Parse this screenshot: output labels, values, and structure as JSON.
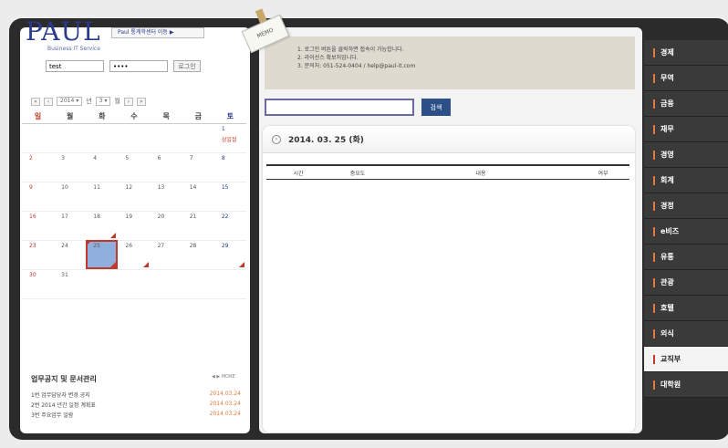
{
  "header": {
    "logo": "PAUL",
    "logo_sub": "Business IT Service",
    "top_button": "Paul 통계학센터 이동 ▶"
  },
  "login": {
    "id_value": "test",
    "pw_value": "••••",
    "button": "로그인"
  },
  "calendar": {
    "year": "2014",
    "year_suffix": "년",
    "month": "3",
    "month_suffix": "월",
    "weekdays": [
      "일",
      "월",
      "화",
      "수",
      "목",
      "금",
      "토"
    ],
    "holiday_label": "삼일절",
    "weeks": [
      [
        "",
        "",
        "",
        "",
        "",
        "",
        "1"
      ],
      [
        "2",
        "3",
        "4",
        "5",
        "6",
        "7",
        "8"
      ],
      [
        "9",
        "10",
        "11",
        "12",
        "13",
        "14",
        "15"
      ],
      [
        "16",
        "17",
        "18",
        "19",
        "20",
        "21",
        "22"
      ],
      [
        "23",
        "24",
        "25",
        "26",
        "27",
        "28",
        "29"
      ],
      [
        "30",
        "31",
        "",
        "",
        "",
        "",
        ""
      ]
    ],
    "today": "25"
  },
  "notices": {
    "title": "업무공지 및 문서관리",
    "more": "◀ ▶ MORE",
    "items": [
      {
        "text": "1번 업무담당자 변경 공지",
        "date": "2014.03.24"
      },
      {
        "text": "2번 2014 년간 일정 계획표",
        "date": "2014.03.24"
      },
      {
        "text": "3번 주요업무 일람",
        "date": "2014.03.24"
      }
    ]
  },
  "memo": {
    "tag": "MEMO",
    "lines": [
      "1. 로그인 버튼을 클릭하면 접속이 가능합니다.",
      "2. 라이선스 확보처입니다.",
      "3. 문의처: 051-524-0404 / help@paul-it.com"
    ]
  },
  "search": {
    "placeholder": "",
    "button": "검색"
  },
  "schedule": {
    "date": "2014. 03. 25 (화)",
    "columns": [
      "시간",
      "중요도",
      "내용",
      "여부"
    ]
  },
  "nav": {
    "items": [
      "경제",
      "무역",
      "금융",
      "재무",
      "경영",
      "회계",
      "경정",
      "e비즈",
      "유통",
      "관광",
      "호텔",
      "외식",
      "교직부",
      "대학원"
    ],
    "active_index": 12
  }
}
